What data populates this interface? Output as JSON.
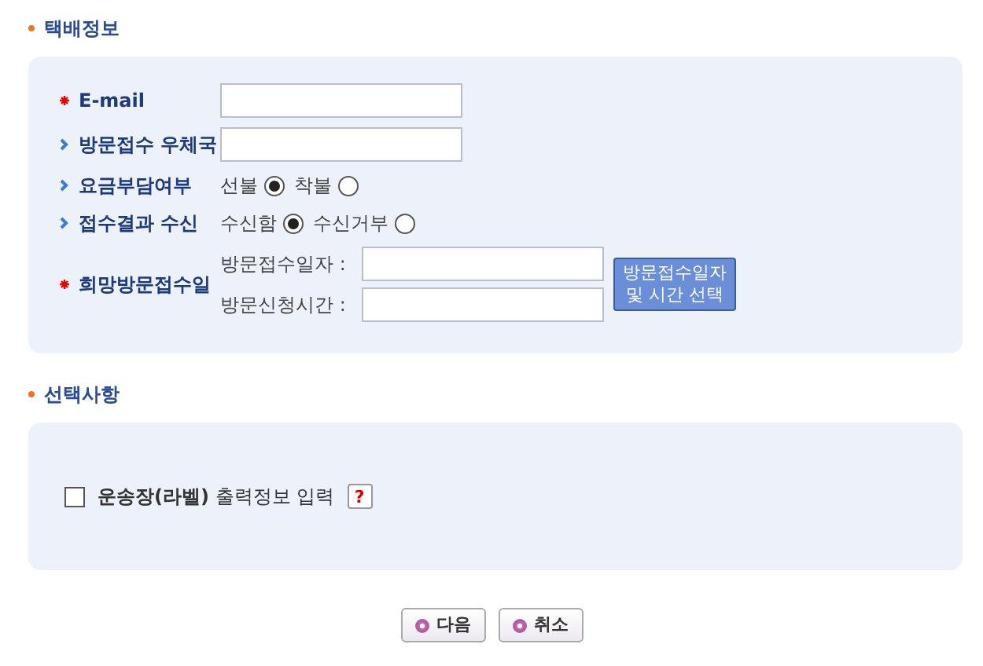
{
  "sections": [
    {
      "title": "택배정보",
      "rows": [
        {
          "kind": "text",
          "required": true,
          "label": "E-mail"
        },
        {
          "kind": "text",
          "required": false,
          "label": "방문접수 우체국"
        },
        {
          "kind": "radio",
          "required": false,
          "label": "요금부담여부",
          "options": [
            {
              "label": "선불",
              "selected": true
            },
            {
              "label": "착불",
              "selected": false
            }
          ]
        },
        {
          "kind": "radio",
          "required": false,
          "label": "접수결과 수신",
          "options": [
            {
              "label": "수신함",
              "selected": true
            },
            {
              "label": "수신거부",
              "selected": false
            }
          ]
        },
        {
          "kind": "datetime",
          "required": true,
          "label": "희망방문접수일",
          "fields": [
            {
              "label": "방문접수일자 :"
            },
            {
              "label": "방문신청시간 :"
            }
          ],
          "button": "방문접수일자 및 시간 선택"
        }
      ]
    },
    {
      "title": "선택사항",
      "checkbox": {
        "label": "**운송장(라벨)** 출력정보 입력",
        "checked": false,
        "help": "?"
      }
    }
  ],
  "buttons": [
    "다음",
    "취소"
  ]
}
